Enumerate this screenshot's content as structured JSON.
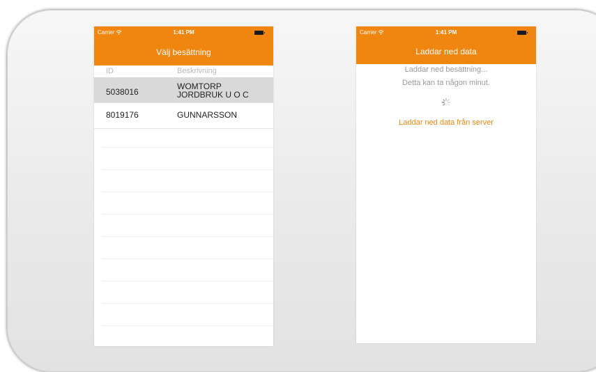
{
  "status_bar": {
    "carrier": "Carrier",
    "time": "1:41 PM"
  },
  "left_screen": {
    "title": "Välj besättning",
    "columns": {
      "id": "ID",
      "description": "Beskrivning"
    },
    "rows": [
      {
        "id": "5038016",
        "description": "WOMTORP JORDBRUK U O C",
        "selected": true
      },
      {
        "id": "8019176",
        "description": "GUNNARSSON",
        "selected": false
      }
    ]
  },
  "right_screen": {
    "title": "Laddar ned data",
    "line1": "Laddar ned besättning...",
    "line2": "Detta kan ta någon minut.",
    "server_status": "Laddar ned data från server"
  },
  "colors": {
    "accent": "#f0860f",
    "selected_row": "#d9d9d9"
  },
  "icons": [
    "wifi-icon",
    "battery-icon",
    "spinner-icon"
  ]
}
